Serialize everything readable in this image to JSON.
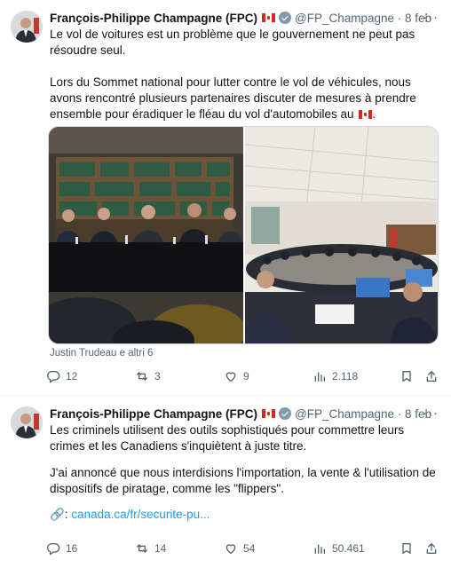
{
  "tweets": [
    {
      "author_name": "François-Philippe Champagne (FPC)",
      "handle": "@FP_Champagne",
      "date": "8 feb",
      "paragraph1": "Le vol de voitures est un problème que le gouvernement ne peut pas résoudre seul.",
      "paragraph2": "Lors du Sommet national pour lutter contre le vol de véhicules, nous avons rencontré plusieurs partenaires discuter de mesures à prendre ensemble pour éradiquer le fléau du vol d'automobiles au",
      "tagged": "Justin Trudeau e altri 6",
      "replies": "12",
      "reposts": "3",
      "likes": "9",
      "views": "2.118"
    },
    {
      "author_name": "François-Philippe Champagne (FPC)",
      "handle": "@FP_Champagne",
      "date": "8 feb",
      "paragraph1": "Les criminels utilisent des outils sophistiqués pour commettre leurs crimes et les Canadiens s'inquiètent à juste titre.",
      "paragraph2": "J'ai annoncé que nous interdisions l'importation, la vente & l'utilisation de dispositifs de piratage, comme les \"flippers\".",
      "link_icon": "🔗:",
      "link_text": "canada.ca/fr/securite-pu...",
      "replies": "16",
      "reposts": "14",
      "likes": "54",
      "views": "50.461"
    }
  ],
  "icons": [
    "more-icon",
    "verified-icon",
    "canada-flag-icon",
    "reply-icon",
    "repost-icon",
    "like-icon",
    "views-icon",
    "bookmark-icon",
    "share-icon"
  ],
  "colors": {
    "accent": "#1d9bf0",
    "muted": "#536471",
    "text": "#0f1419",
    "verified": "#829aab",
    "flag_red": "#d52b1e"
  }
}
